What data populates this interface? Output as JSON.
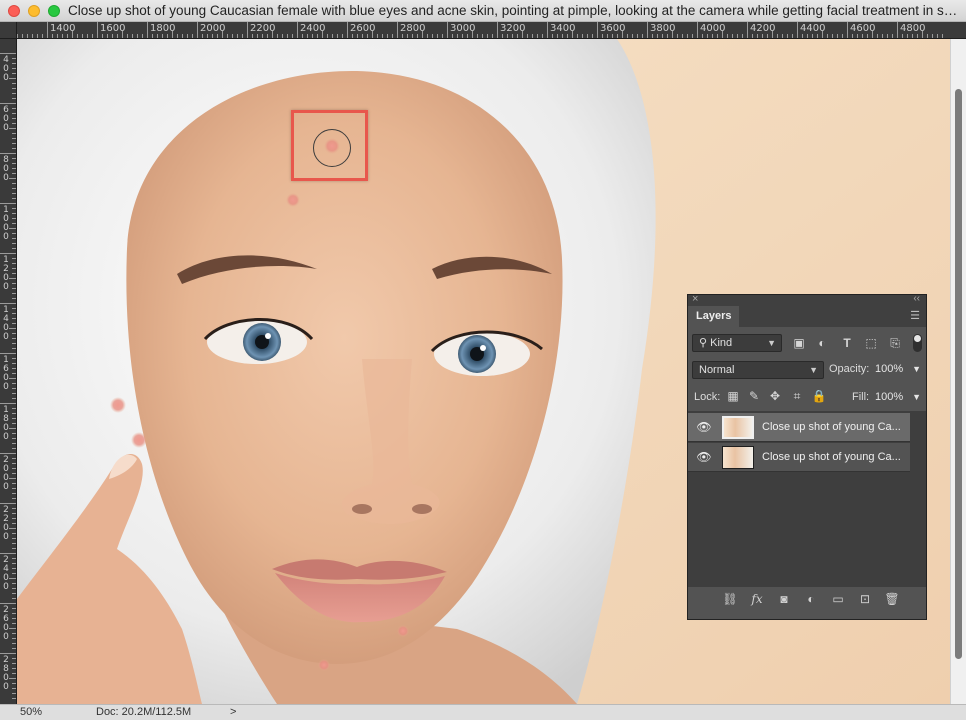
{
  "window": {
    "title": "Close up shot of young Caucasian female with blue eyes and acne skin, pointing at pimple, looking at the camera while getting facial treatment in spa..."
  },
  "ruler": {
    "horizontal_labels": [
      "1400",
      "1600",
      "1800",
      "2000",
      "2200",
      "2400",
      "2600",
      "2800",
      "3000",
      "3200",
      "3400",
      "3600",
      "3800",
      "4000",
      "4200",
      "4400",
      "4600",
      "4800"
    ],
    "vertical_labels": [
      "400",
      "600",
      "800",
      "1000",
      "1200",
      "1400",
      "1600",
      "1800",
      "2000",
      "2200",
      "2400",
      "2600",
      "2800"
    ]
  },
  "status": {
    "zoom": "50%",
    "doc": "Doc: 20.2M/112.5M",
    "arrow": ">"
  },
  "layers_panel": {
    "tab_label": "Layers",
    "filter_label": "Kind",
    "blend_mode": "Normal",
    "opacity_label": "Opacity:",
    "opacity_value": "100%",
    "lock_label": "Lock:",
    "fill_label": "Fill:",
    "fill_value": "100%",
    "layers": [
      {
        "name": "Close up shot of young Ca...",
        "visible": true,
        "selected": true
      },
      {
        "name": "Close up shot of young Ca...",
        "visible": true,
        "selected": false
      }
    ]
  },
  "colors": {
    "selection_marker": "#e8574c",
    "panel_bg": "#535353",
    "background_peach": "#f2d9bb"
  }
}
